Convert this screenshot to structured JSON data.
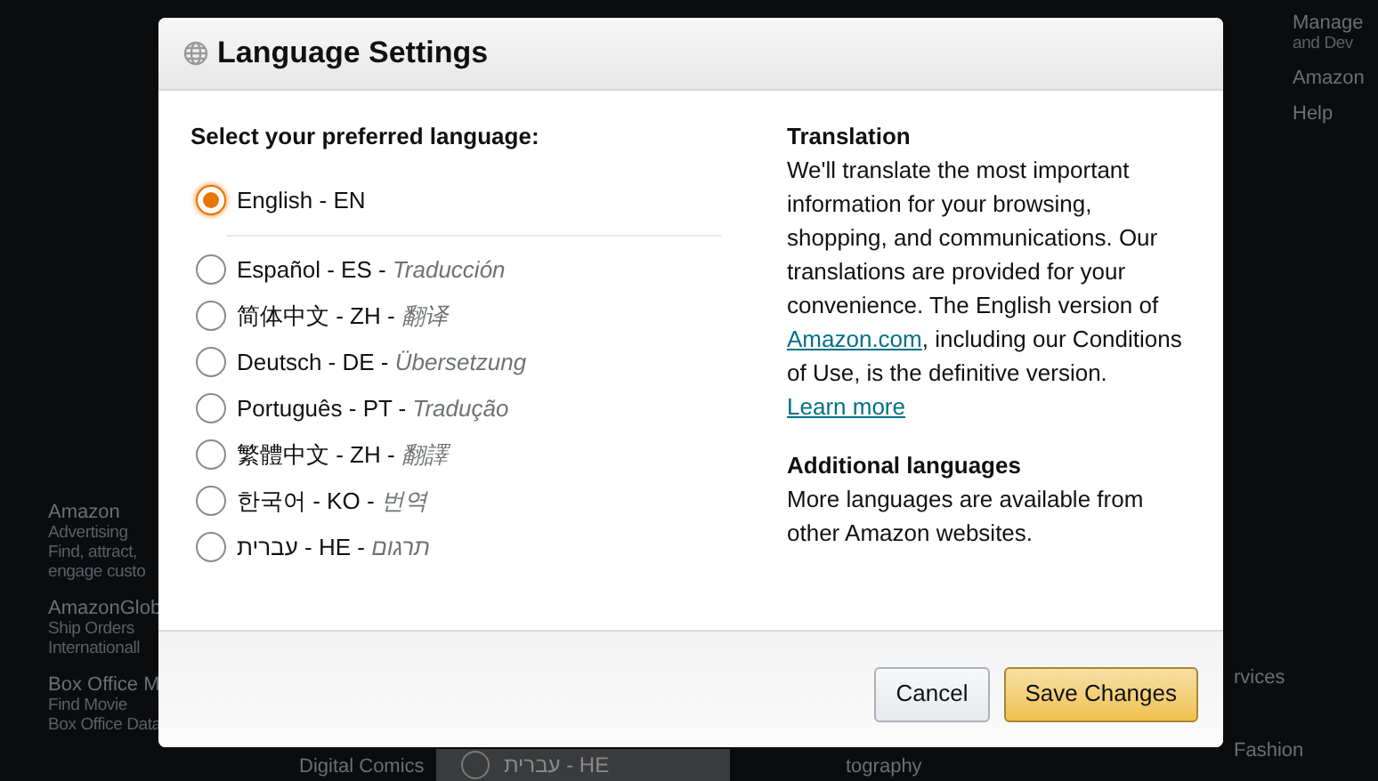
{
  "backdrop": {
    "columns": [
      {
        "items": [
          {
            "title": "Manage",
            "lines": [
              "and Dev"
            ]
          },
          {
            "title": "Amazon"
          },
          {
            "title": "Help"
          }
        ]
      },
      {
        "items": [
          {
            "title": "Amazon",
            "lines": [
              "Advertising",
              "Find, attract,",
              "engage custo"
            ]
          },
          {
            "title": "AmazonGlob",
            "lines": [
              "Ship Orders",
              "Internationall"
            ]
          },
          {
            "title": "Box Office M",
            "lines": [
              "Find Movie",
              "Box Office Data"
            ]
          }
        ]
      },
      {
        "items": [
          {
            "title": "Digital Comics"
          }
        ]
      },
      {
        "items": [
          {
            "title": "tography"
          }
        ]
      },
      {
        "items": [
          {
            "title": "rvices"
          },
          {
            "title": "Fashion"
          }
        ]
      }
    ],
    "behind_option": {
      "label": "עברית - HE",
      "selected": false
    }
  },
  "dialog": {
    "title": "Language Settings",
    "prompt": "Select your preferred language:",
    "languages": [
      {
        "label": "English - EN",
        "selected": true
      },
      {
        "label": "Español - ES - ",
        "translation": "Traducción",
        "selected": false
      },
      {
        "label": "简体中文 - ZH - ",
        "translation": "翻译",
        "selected": false
      },
      {
        "label": "Deutsch - DE - ",
        "translation": "Übersetzung",
        "selected": false
      },
      {
        "label": "Português - PT - ",
        "translation": "Tradução",
        "selected": false
      },
      {
        "label": "繁體中文 - ZH - ",
        "translation": "翻譯",
        "selected": false
      },
      {
        "label": "한국어 - KO - ",
        "translation": "번역",
        "selected": false
      },
      {
        "label": "עברית - HE - ",
        "translation": "תרגום",
        "selected": false
      }
    ],
    "translation": {
      "heading": "Translation",
      "text": "We'll translate the most important information for your browsing, shopping, and communications. Our translations are provided for your convenience. The English version of ",
      "link": "Amazon.com",
      "text2": ", including our Conditions of Use, is the definitive version. ",
      "link2": "Learn more"
    },
    "additional": {
      "heading": "Additional languages",
      "text": "More languages are available from other Amazon websites."
    },
    "buttons": [
      {
        "label": "Cancel",
        "kind": "secondary"
      },
      {
        "label": "Save Changes",
        "kind": "primary"
      }
    ]
  }
}
